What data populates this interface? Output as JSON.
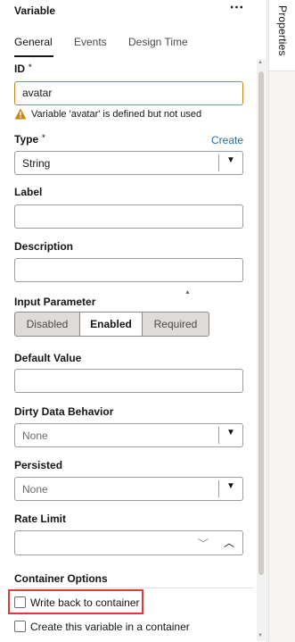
{
  "header": {
    "title": "Variable",
    "more_icon": "more-horizontal-icon"
  },
  "rail": {
    "tab_label": "Properties"
  },
  "tabs": [
    {
      "label": "General",
      "active": true
    },
    {
      "label": "Events",
      "active": false
    },
    {
      "label": "Design Time",
      "active": false
    }
  ],
  "fields": {
    "id": {
      "label": "ID",
      "required_mark": "*",
      "value": "avatar",
      "warning": "Variable 'avatar' is defined but not used"
    },
    "type": {
      "label": "Type",
      "required_mark": "*",
      "value": "String",
      "create_link": "Create"
    },
    "label": {
      "label": "Label",
      "value": ""
    },
    "description": {
      "label": "Description",
      "value": ""
    },
    "input_parameter": {
      "label": "Input Parameter",
      "options": [
        "Disabled",
        "Enabled",
        "Required"
      ],
      "selected": "Enabled"
    },
    "default_value": {
      "label": "Default Value",
      "value": ""
    },
    "dirty_data_behavior": {
      "label": "Dirty Data Behavior",
      "value": "None"
    },
    "persisted": {
      "label": "Persisted",
      "value": "None"
    },
    "rate_limit": {
      "label": "Rate Limit",
      "value": ""
    }
  },
  "container_options": {
    "label": "Container Options",
    "write_back": {
      "label": "Write back to container",
      "checked": false
    },
    "create_in_container": {
      "label": "Create this variable in a container",
      "checked": false
    }
  },
  "colors": {
    "warning": "#c3871c",
    "link": "#2a6ea0",
    "highlight": "#e03b3b"
  }
}
